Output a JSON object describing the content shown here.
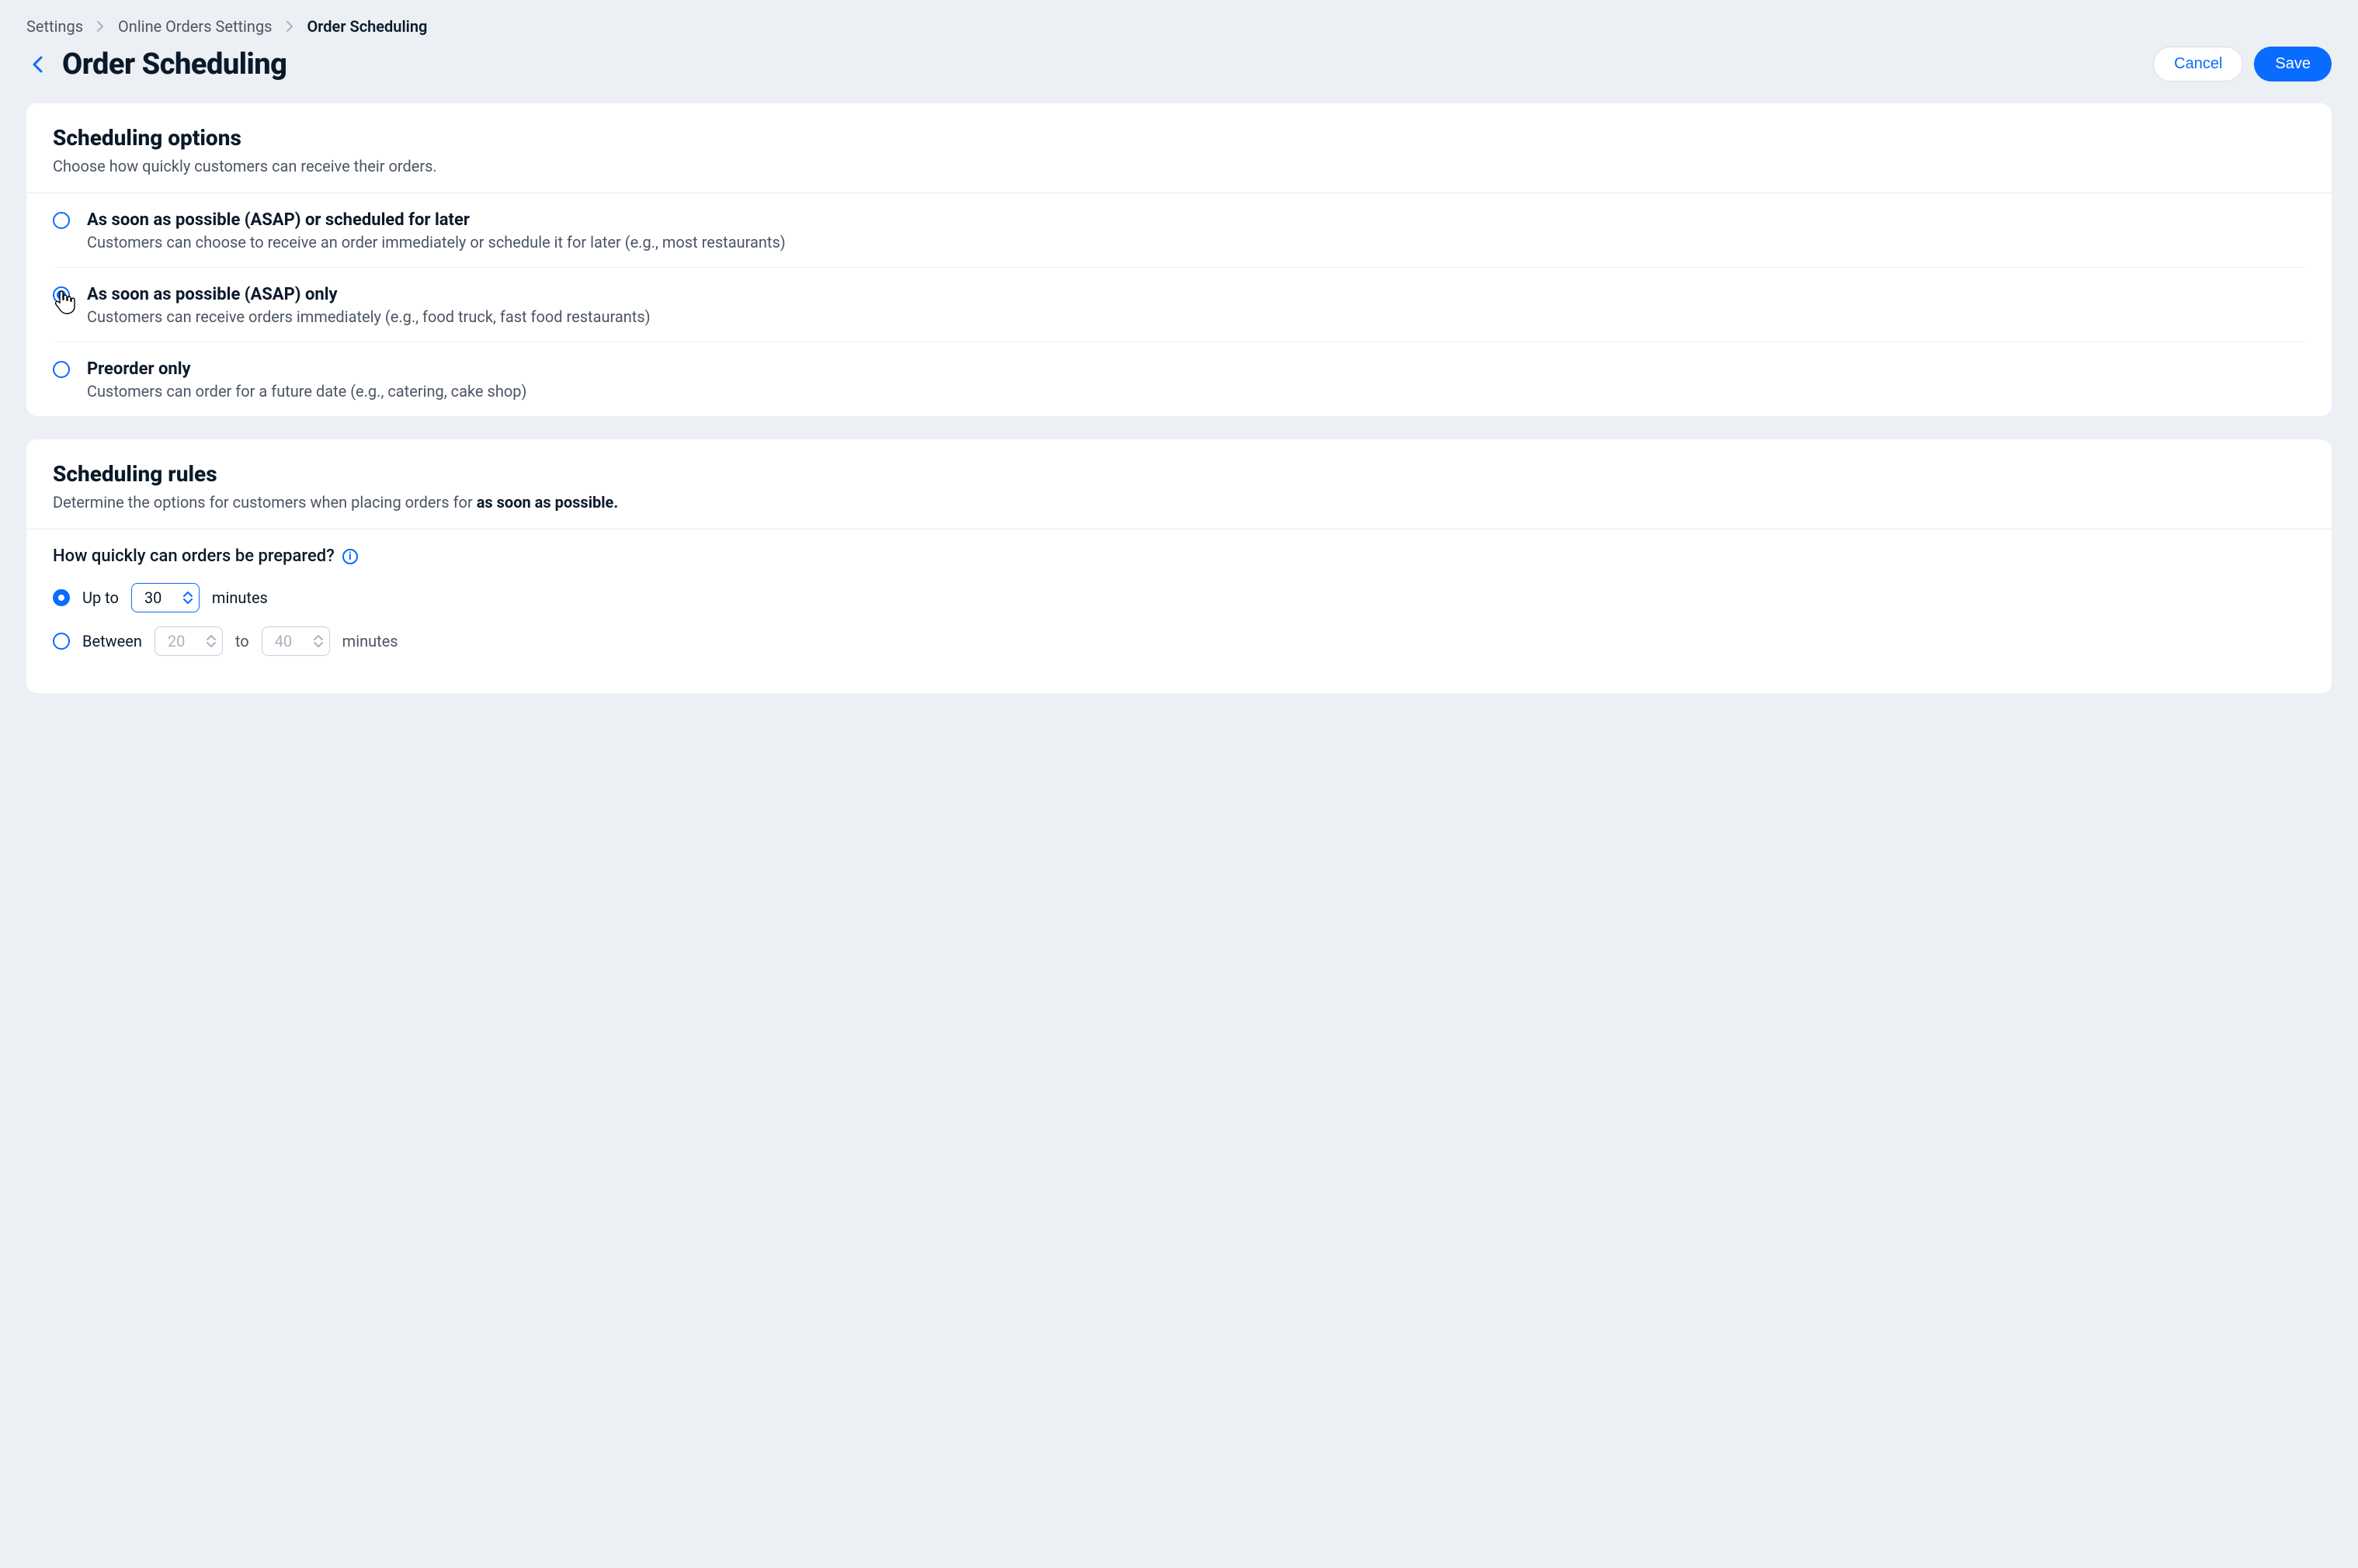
{
  "breadcrumb": {
    "items": [
      "Settings",
      "Online Orders Settings",
      "Order Scheduling"
    ]
  },
  "header": {
    "title": "Order Scheduling",
    "cancel": "Cancel",
    "save": "Save"
  },
  "scheduling_options": {
    "title": "Scheduling options",
    "sub": "Choose how quickly customers can receive their orders.",
    "selected_index": 1,
    "items": [
      {
        "title": "As soon as possible (ASAP) or scheduled for later",
        "desc": "Customers can choose to receive an order immediately or schedule it for later (e.g., most restaurants)"
      },
      {
        "title": "As soon as possible (ASAP)  only",
        "desc": "Customers can receive orders immediately (e.g., food truck, fast food restaurants)"
      },
      {
        "title": "Preorder only",
        "desc": "Customers can order for a future date (e.g., catering, cake shop)"
      }
    ]
  },
  "scheduling_rules": {
    "title": "Scheduling rules",
    "sub_prefix": "Determine the options for customers when placing orders for ",
    "sub_strong": "as soon as possible.",
    "question": "How quickly can orders be prepared?",
    "upto": {
      "prefix": "Up to",
      "value": "30",
      "suffix": "minutes"
    },
    "between": {
      "prefix": "Between",
      "from": "20",
      "connector": "to",
      "to": "40",
      "suffix": "minutes"
    },
    "prep_selected": "upto"
  },
  "colors": {
    "accent": "#0a6bff",
    "text": "#0b1a2a",
    "muted": "#4b5564",
    "bg": "#ecf0f4"
  }
}
